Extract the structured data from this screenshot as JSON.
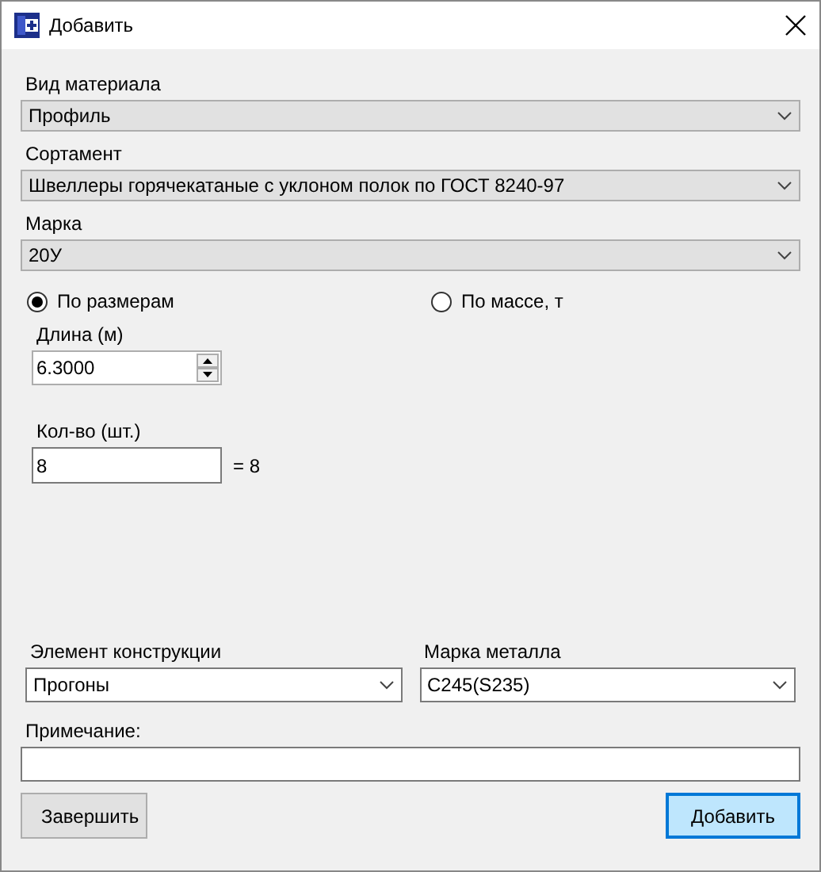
{
  "window": {
    "title": "Добавить"
  },
  "material_type": {
    "label": "Вид материала",
    "value": "Профиль"
  },
  "assortment": {
    "label": "Сортамент",
    "value": "Швеллеры горячекатаные с уклоном полок по ГОСТ 8240-97"
  },
  "grade": {
    "label": "Марка",
    "value": "20У"
  },
  "measure_options": [
    {
      "label": "По размерам",
      "selected": true
    },
    {
      "label": "По массе, т",
      "selected": false
    }
  ],
  "length": {
    "label": "Длина (м)",
    "value": "6.3000"
  },
  "quantity": {
    "label": "Кол-во (шт.)",
    "value": "8",
    "result": "= 8"
  },
  "structure_element": {
    "label": "Элемент конструкции",
    "value": "Прогоны"
  },
  "steel_grade": {
    "label": "Марка металла",
    "value": "С245(S235)"
  },
  "note": {
    "label": "Примечание:"
  },
  "buttons": [
    {
      "label": "Завершить",
      "focused": false
    },
    {
      "label": "Добавить",
      "focused": true
    }
  ]
}
